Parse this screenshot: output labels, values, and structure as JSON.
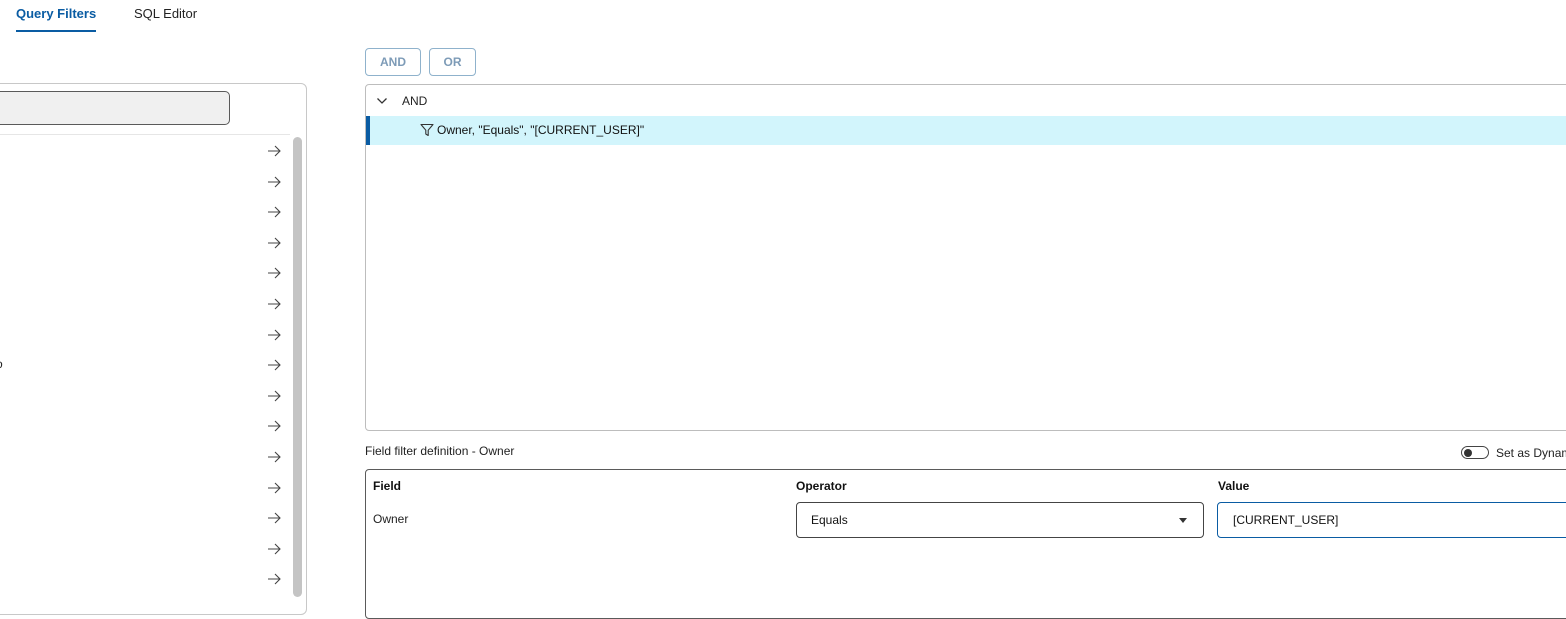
{
  "tabs": [
    {
      "label": "Query Filters",
      "active": true
    },
    {
      "label": "SQL Editor",
      "active": false
    }
  ],
  "left_panel": {
    "search": {
      "value": "",
      "placeholder": ""
    },
    "field_rows": 15,
    "cut_text": "o"
  },
  "operators": {
    "and_label": "AND",
    "or_label": "OR"
  },
  "tree": {
    "root_label": "AND",
    "selected_node_label": "Owner, \"Equals\", \"[CURRENT_USER]\""
  },
  "definition": {
    "title": "Field filter definition - Owner",
    "toggle_label": "Set as Dynamic",
    "headers": {
      "field": "Field",
      "operator": "Operator",
      "value": "Value"
    },
    "field_value": "Owner",
    "operator_value": "Equals",
    "value_input": "[CURRENT_USER]"
  },
  "colors": {
    "accent": "#0a5ca3",
    "selected_row": "#d2f5fc"
  },
  "icons": [
    "arrow-right-icon",
    "chevron-down-icon",
    "filter-icon",
    "caret-down-icon"
  ]
}
